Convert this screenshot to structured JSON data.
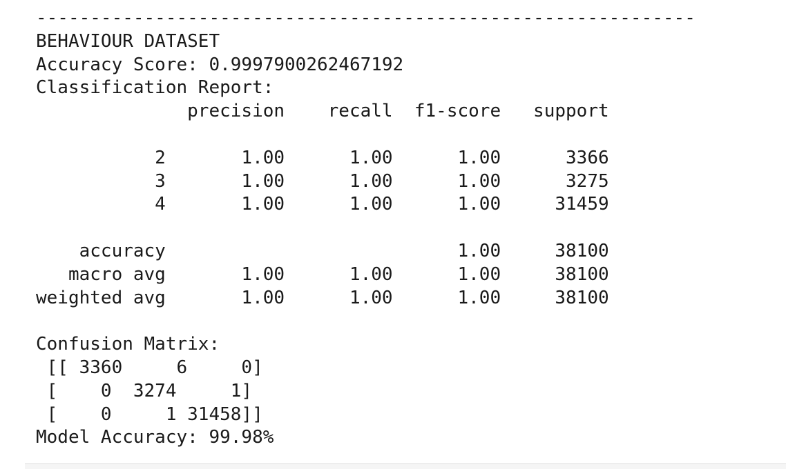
{
  "output": {
    "lines": [
      "-------------------------------------------------------------",
      "BEHAVIOUR DATASET",
      "Accuracy Score: 0.9997900262467192",
      "Classification Report:",
      "              precision    recall  f1-score   support",
      "",
      "           2       1.00      1.00      1.00      3366",
      "           3       1.00      1.00      1.00      3275",
      "           4       1.00      1.00      1.00     31459",
      "",
      "    accuracy                           1.00     38100",
      "   macro avg       1.00      1.00      1.00     38100",
      "weighted avg       1.00      1.00      1.00     38100",
      "",
      "Confusion Matrix:",
      " [[ 3360     6     0]",
      " [    0  3274     1]",
      " [    0     1 31458]]",
      "Model Accuracy: 99.98%"
    ]
  }
}
